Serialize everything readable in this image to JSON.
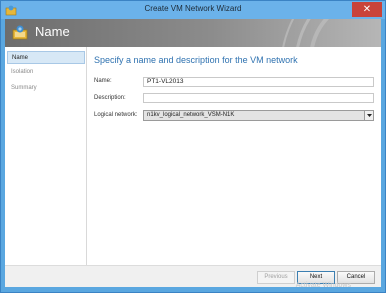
{
  "window": {
    "title": "Create VM Network Wizard",
    "close_symbol": "✕",
    "icon": "network-wizard-icon"
  },
  "banner": {
    "title": "Name",
    "icon": "network-wizard-icon"
  },
  "sidebar": {
    "items": [
      {
        "label": "Name",
        "active": true
      },
      {
        "label": "Isolation",
        "active": false
      },
      {
        "label": "Summary",
        "active": false
      }
    ]
  },
  "main": {
    "heading": "Specify a name and description for the VM network",
    "name_label": "Name:",
    "name_value": "PT1-VL2013",
    "description_label": "Description:",
    "description_value": "",
    "logical_network_label": "Logical network:",
    "logical_network_value": "n1kv_logical_network_VSM-N1K"
  },
  "footer": {
    "previous_label": "Previous",
    "next_label": "Next",
    "cancel_label": "Cancel",
    "watermark": "Activate Windows"
  },
  "colors": {
    "accent": "#2f72b0",
    "titlebar": "#6bb2ea",
    "close": "#c9433a"
  }
}
